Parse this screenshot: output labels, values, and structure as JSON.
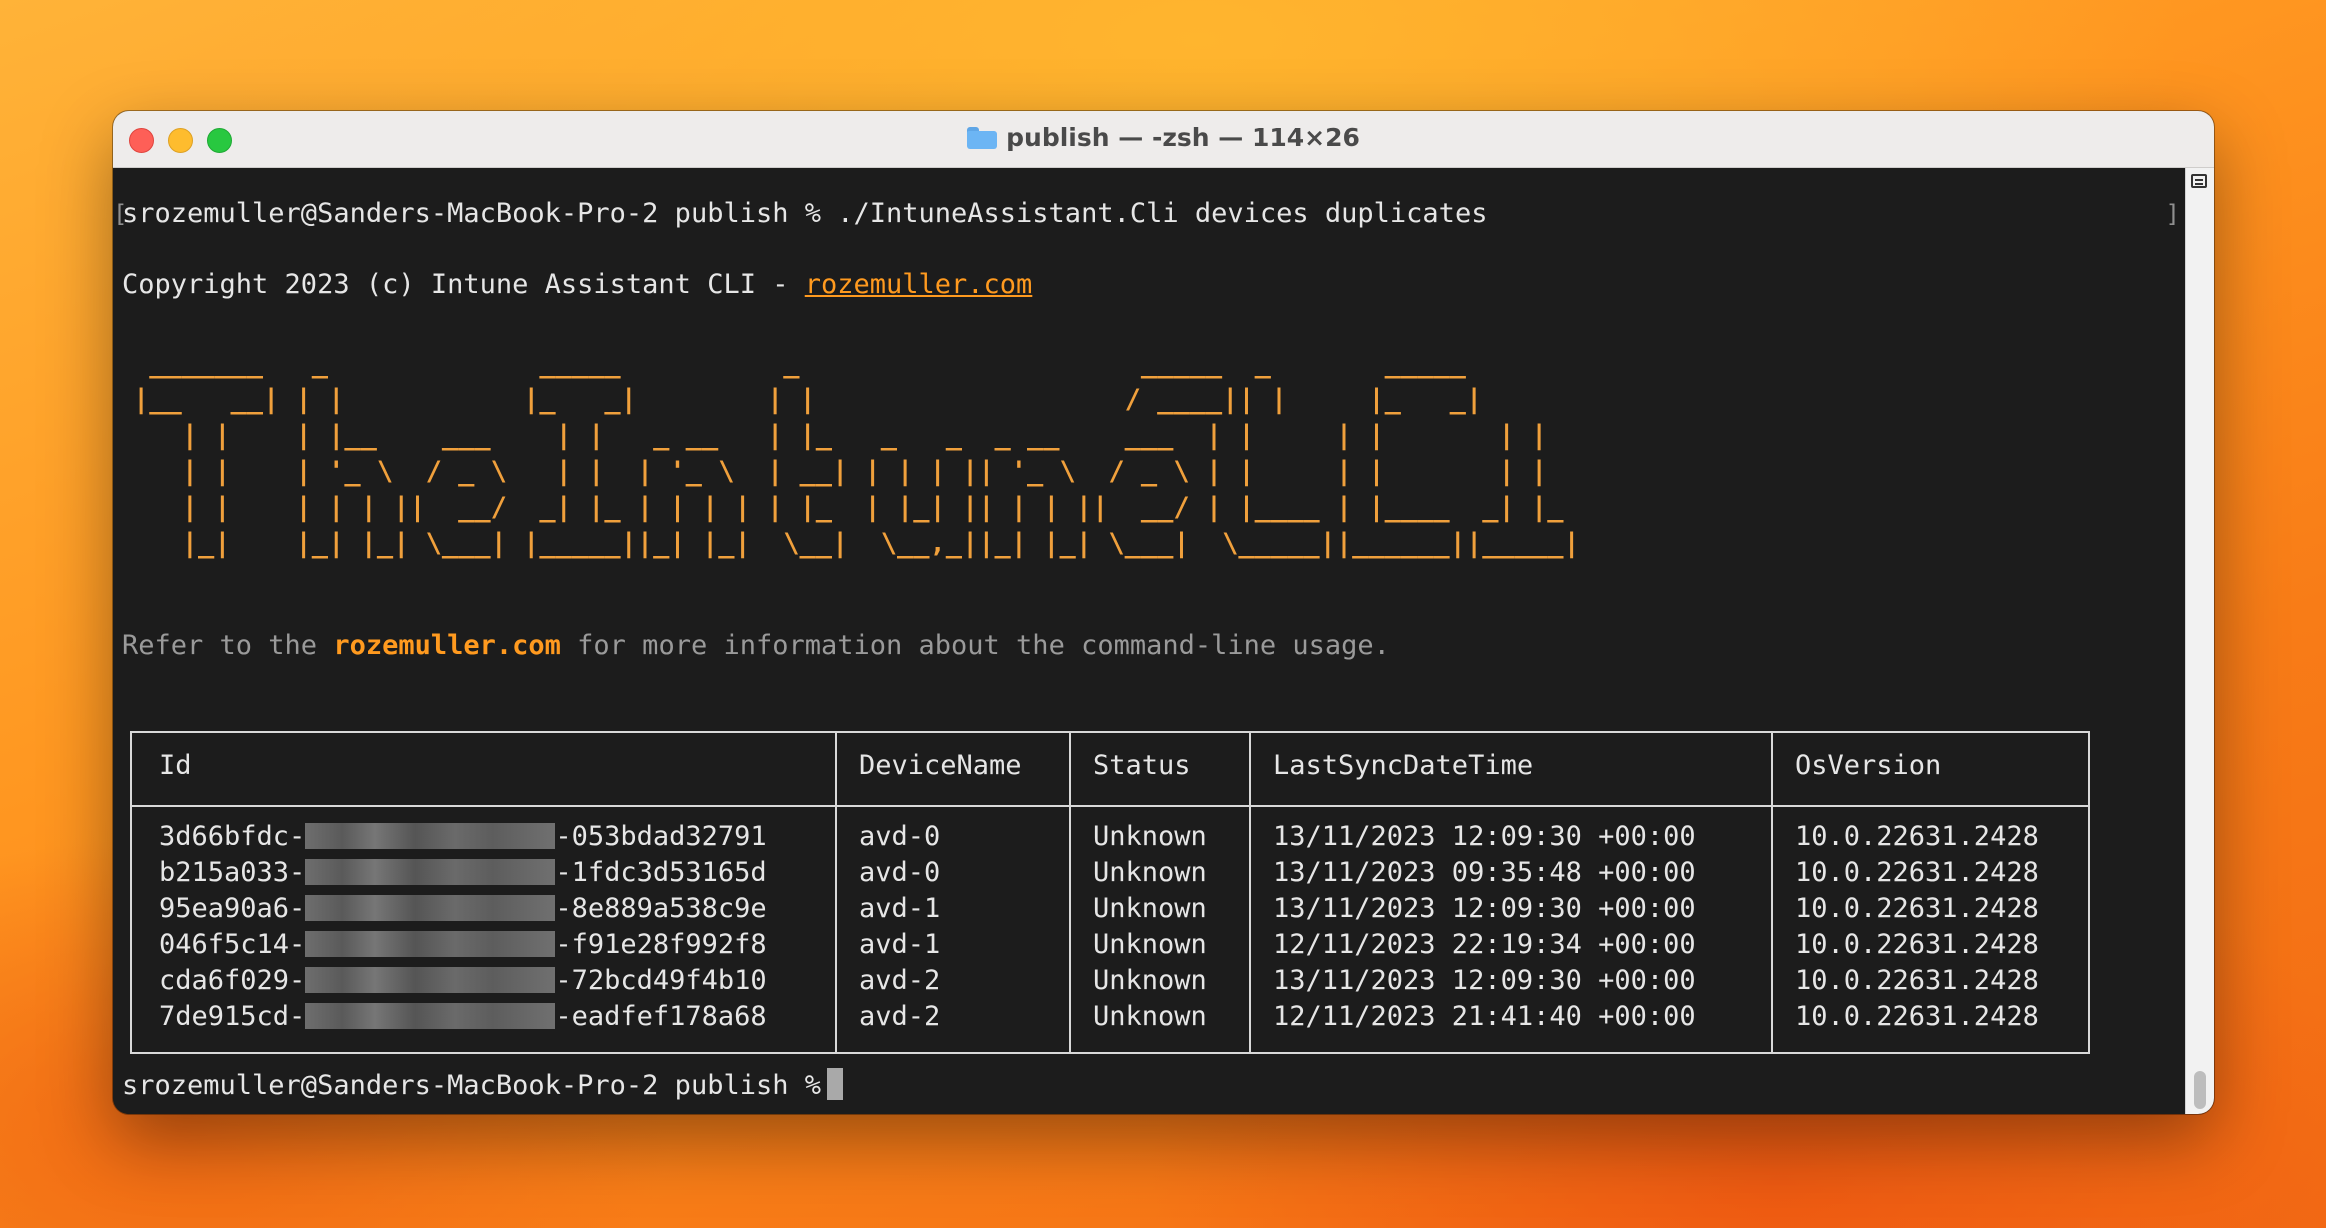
{
  "window": {
    "title": "publish — -zsh — 114×26",
    "folder_icon": "folder-icon"
  },
  "terminal": {
    "command": "srozemuller@Sanders-MacBook-Pro-2 publish % ./IntuneAssistant.Cli devices duplicates",
    "copyright_prefix": "Copyright 2023 (c) Intune Assistant CLI - ",
    "copyright_link": "rozemuller.com",
    "banner": " _______   _             _____          _                     _____  _       _____ \n|__   __| | |           |_   _|        | |                   / ____|| |     |_   _|\n   | |    | |__    ___    | |   _ __   | |_   _   _  _ __    ___  | |     | |       | |  \n   | |    | '_ \\  / _ \\   | |  | '_ \\  | __| | | | || '_ \\  / _ \\ | |     | |       | |  \n   | |    | | | ||  __/  _| |_ | | | | | |_  | |_| || | | ||  __/ | |____ | |____  _| |_ \n   |_|    |_| |_| \\___| |_____||_| |_|  \\__|  \\__,_||_| |_| \\___|  \\_____||______||_____|",
    "info_prefix": "Refer to the ",
    "info_link": "rozemuller.com",
    "info_suffix": " for more information about the command-line usage.",
    "prompt": "srozemuller@Sanders-MacBook-Pro-2 publish %",
    "accent_color": "#ff9a1f",
    "banner_color": "#f0a03c",
    "background_color": "#1c1c1c"
  },
  "table": {
    "headers": [
      "Id",
      "DeviceName",
      "Status",
      "LastSyncDateTime",
      "OsVersion"
    ],
    "rows": [
      {
        "id_start": "3d66bfdc-",
        "id_end": "-053bdad32791",
        "device": "avd-0",
        "status": "Unknown",
        "sync": "13/11/2023 12:09:30 +00:00",
        "os": "10.0.22631.2428"
      },
      {
        "id_start": "b215a033-",
        "id_end": "-1fdc3d53165d",
        "device": "avd-0",
        "status": "Unknown",
        "sync": "13/11/2023 09:35:48 +00:00",
        "os": "10.0.22631.2428"
      },
      {
        "id_start": "95ea90a6-",
        "id_end": "-8e889a538c9e",
        "device": "avd-1",
        "status": "Unknown",
        "sync": "13/11/2023 12:09:30 +00:00",
        "os": "10.0.22631.2428"
      },
      {
        "id_start": "046f5c14-",
        "id_end": "-f91e28f992f8",
        "device": "avd-1",
        "status": "Unknown",
        "sync": "12/11/2023 22:19:34 +00:00",
        "os": "10.0.22631.2428"
      },
      {
        "id_start": "cda6f029-",
        "id_end": "-72bcd49f4b10",
        "device": "avd-2",
        "status": "Unknown",
        "sync": "13/11/2023 12:09:30 +00:00",
        "os": "10.0.22631.2428"
      },
      {
        "id_start": "7de915cd-",
        "id_end": "-eadfef178a68",
        "device": "avd-2",
        "status": "Unknown",
        "sync": "12/11/2023 21:41:40 +00:00",
        "os": "10.0.22631.2428"
      }
    ]
  }
}
